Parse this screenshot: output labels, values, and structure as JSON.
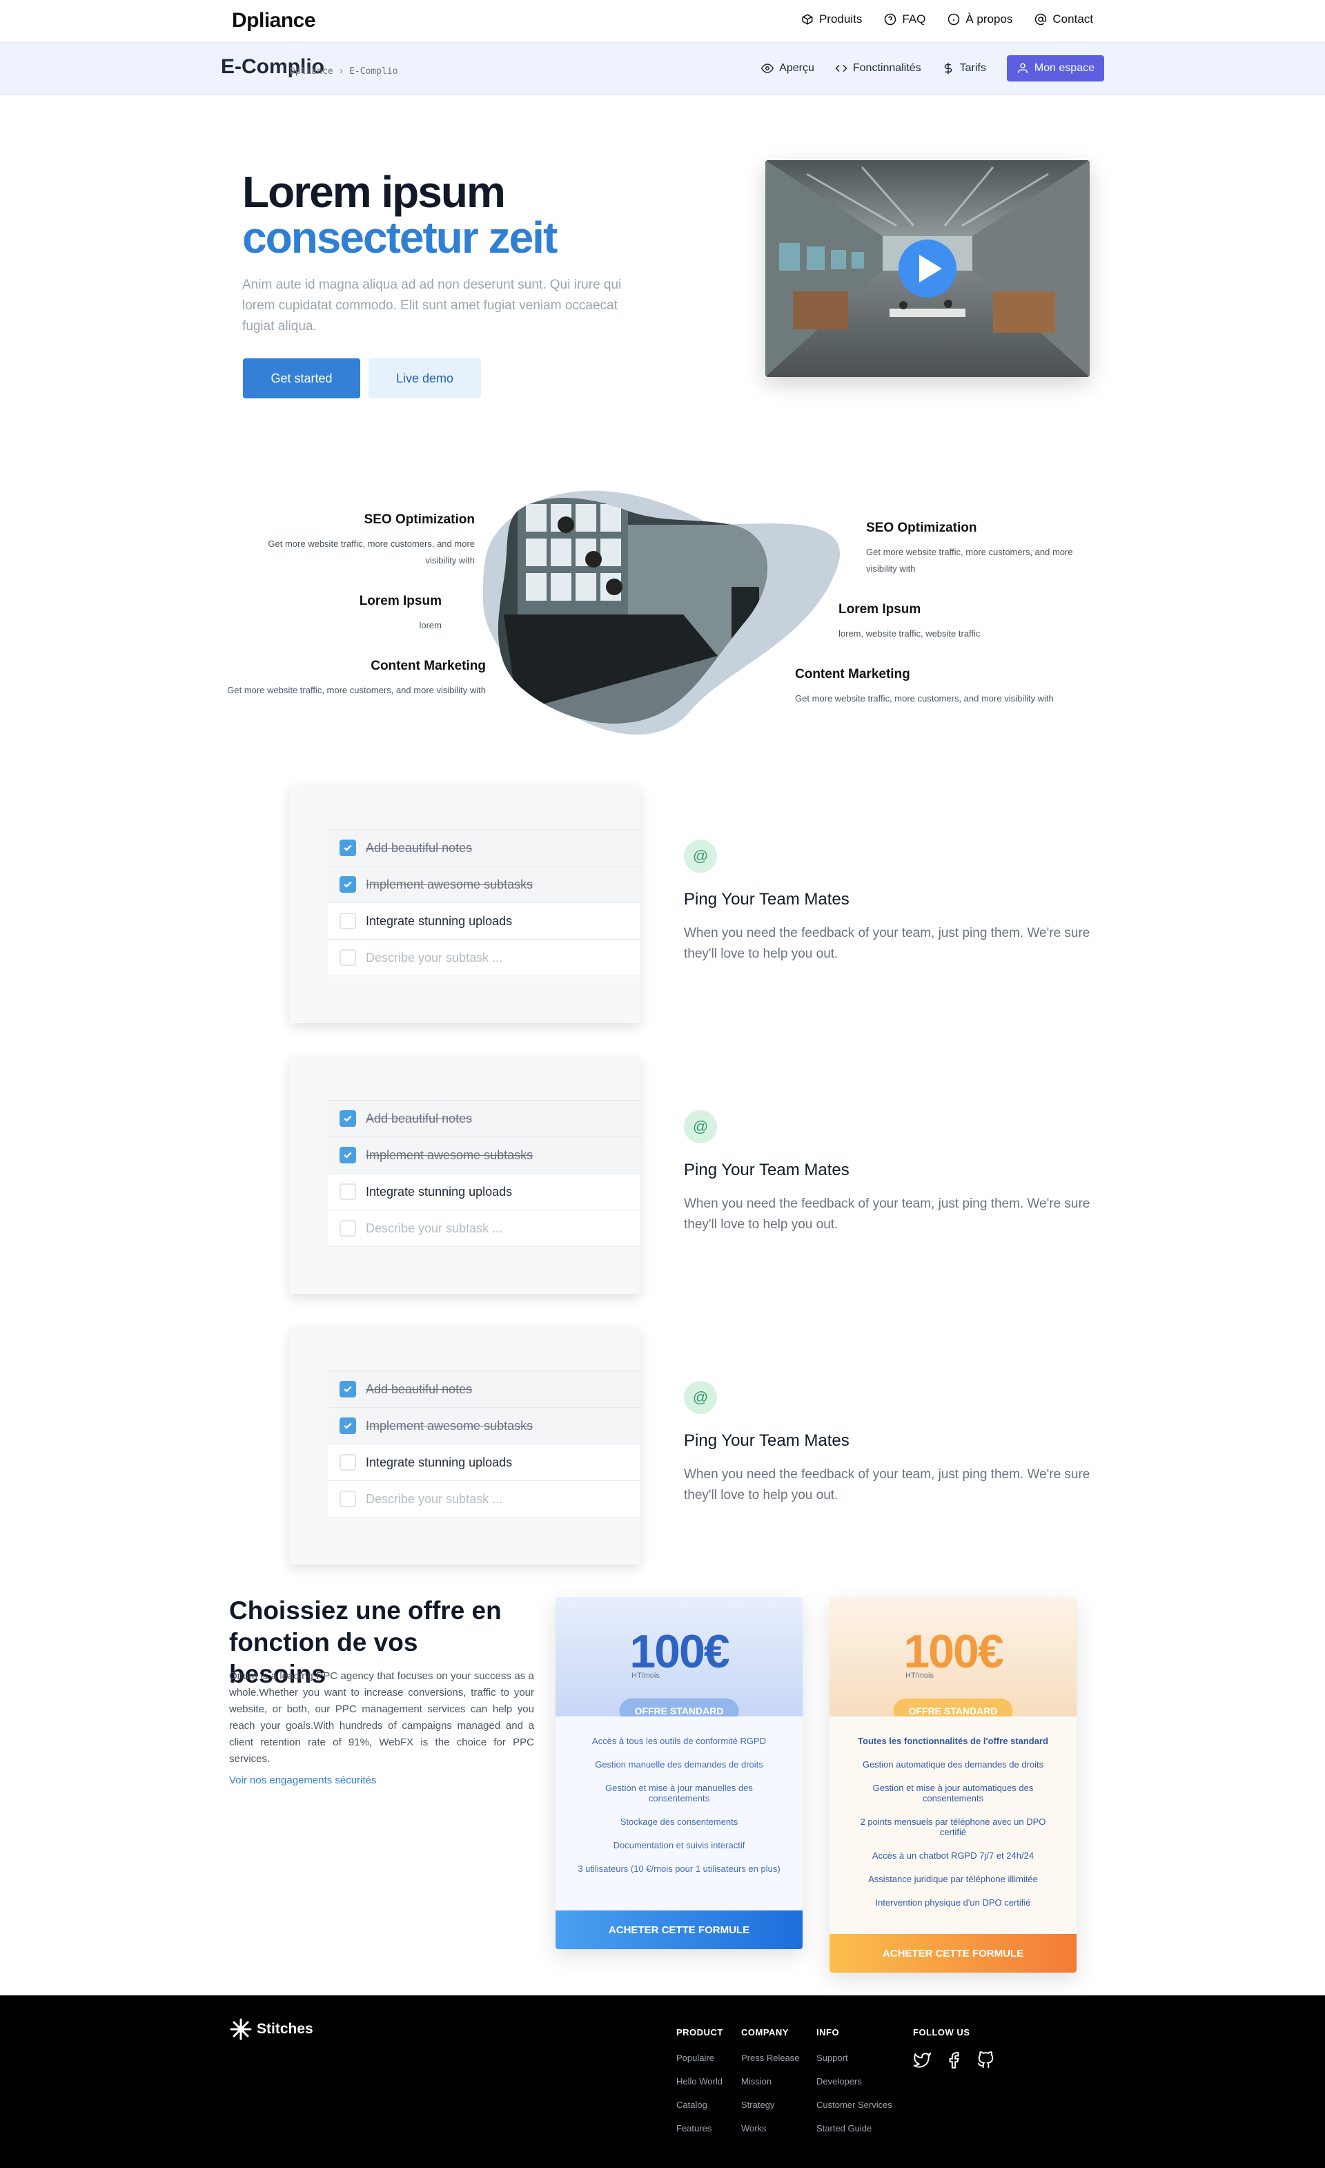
{
  "topbar": {
    "brand": "Dpliance",
    "nav": [
      {
        "label": "Produits",
        "icon": "box-icon"
      },
      {
        "label": "FAQ",
        "icon": "help-circle-icon"
      },
      {
        "label": "À propos",
        "icon": "info-icon"
      },
      {
        "label": "Contact",
        "icon": "at-sign-icon"
      }
    ]
  },
  "subbar": {
    "title": "E-Complio",
    "breadcrumb": "Dpliance › E-Complio",
    "nav": [
      {
        "label": "Aperçu",
        "icon": "eye-icon"
      },
      {
        "label": "Fonctinnalités",
        "icon": "code-icon"
      },
      {
        "label": "Tarifs",
        "icon": "dollar-icon"
      }
    ],
    "account_button": "Mon espace"
  },
  "hero": {
    "title_line1": "Lorem ipsum",
    "title_line2": "consectetur zeit",
    "text": "Anim aute id magna aliqua ad ad non deserunt sunt. Qui irure qui lorem cupidatat commodo. Elit sunt amet fugiat veniam occaecat fugiat aliqua.",
    "primary_button": "Get started",
    "secondary_button": "Live demo"
  },
  "features": {
    "left": [
      {
        "title": "SEO Optimization",
        "desc": "Get more website traffic, more customers, and more visibility with"
      },
      {
        "title": "Lorem Ipsum",
        "desc": "lorem"
      },
      {
        "title": "Content Marketing",
        "desc": "Get more website traffic, more customers, and more visibility with"
      }
    ],
    "right": [
      {
        "title": "SEO Optimization",
        "desc": "Get more website traffic, more customers, and more visibility with"
      },
      {
        "title": "Lorem Ipsum",
        "desc": "lorem, website traffic, website traffic"
      },
      {
        "title": "Content Marketing",
        "desc": "Get more website traffic, more customers, and more visibility with"
      }
    ]
  },
  "tasks": [
    {
      "label": "Add beautiful notes",
      "done": true
    },
    {
      "label": "Implement awesome subtasks",
      "done": true
    },
    {
      "label": "Integrate stunning uploads",
      "done": false
    },
    {
      "label": "Describe your subtask ...",
      "placeholder": true
    }
  ],
  "ping": {
    "icon": "@",
    "title": "Ping Your Team Mates",
    "desc": "When you need the feedback of your team, just ping them. We're sure they'll love to help you out."
  },
  "pricing": {
    "title": "Choissiez une offre en fonction de vos besoins",
    "text": "Onum is a leading PPC agency that focuses on your success as a whole.Whether you want to increase conversions, traffic to your website, or both, our PPC management services can help you reach your goals.With hundreds of campaigns managed and a client retention rate of 91%, WebFX is the choice for PPC services.",
    "link": "Voir nos engagements sécurités",
    "plans": [
      {
        "price": "100€",
        "period": "HT/mois",
        "badge": "OFFRE STANDARD",
        "features": [
          "Accès à tous les outils de conformité RGPD",
          "Gestion manuelle des demandes de droits",
          "Gestion et mise à jour manuelles des consentements",
          "Stockage des consentements",
          "Documentation et suivis interactif",
          "3 utilisateurs (10 €/mois pour 1 utilisateurs en plus)"
        ],
        "button": "ACHETER CETTE FORMULE"
      },
      {
        "price": "100€",
        "period": "HT/mois",
        "badge": "OFFRE STANDARD",
        "features": [
          "Toutes les fonctionnalités de l'offre standard",
          "Gestion automatique des demandes de droits",
          "Gestion et mise à jour automatiques des consentements",
          "2 points mensuels par téléphone avec un DPO certifié",
          "Accès à un chatbot RGPD 7j/7 et 24h/24",
          "Assistance juridique par téléphone illimitée",
          "Intervention physique d'un DPO certifié"
        ],
        "button": "ACHETER CETTE FORMULE"
      }
    ]
  },
  "footer": {
    "logo": "Stitches",
    "columns": [
      {
        "title": "PRODUCT",
        "links": [
          "Populaire",
          "Hello World",
          "Catalog",
          "Features"
        ]
      },
      {
        "title": "COMPANY",
        "links": [
          "Press Release",
          "Mission",
          "Strategy",
          "Works"
        ]
      },
      {
        "title": "INFO",
        "links": [
          "Support",
          "Developers",
          "Customer Services",
          "Started Guide"
        ]
      }
    ],
    "follow_title": "FOLLOW US",
    "social": [
      "twitter-icon",
      "facebook-icon",
      "github-icon"
    ]
  },
  "colors": {
    "accent_blue": "#3380d6",
    "account_button": "#5b5fe0",
    "orange_plan": "#f39a3f"
  }
}
